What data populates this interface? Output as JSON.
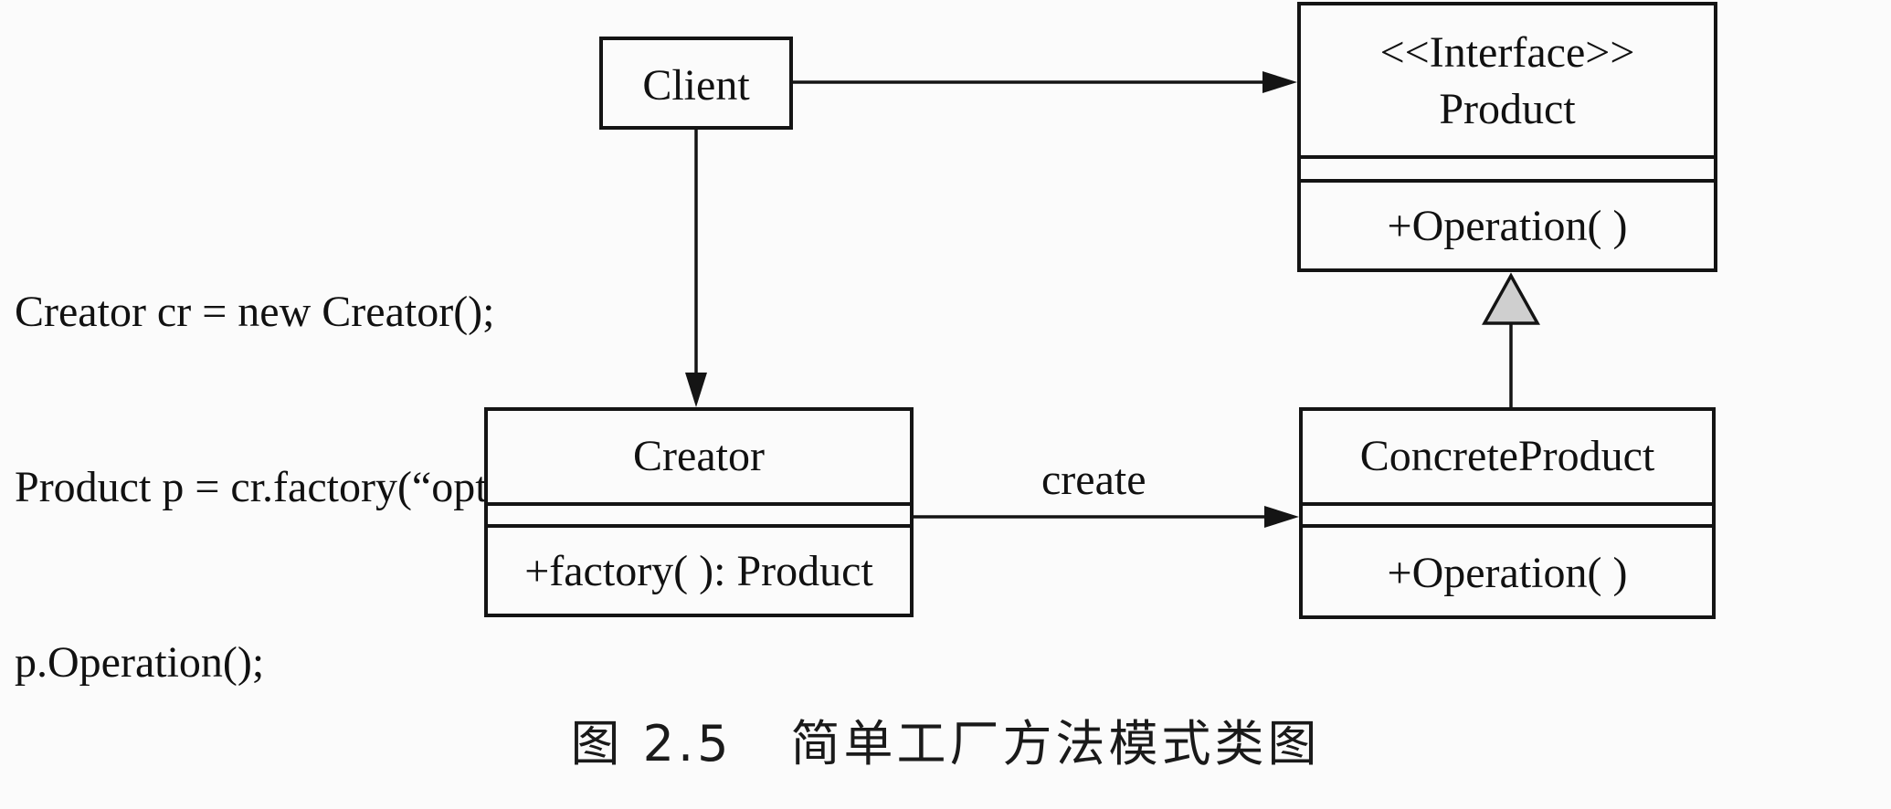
{
  "code_lines": [
    "Creator cr = new Creator();",
    "Product p = cr.factory(“option”);",
    "p.Operation();"
  ],
  "classes": {
    "client": {
      "name": "Client"
    },
    "product": {
      "stereotype": "<<Interface>>",
      "name": "Product",
      "operation": "+Operation( )"
    },
    "creator": {
      "name": "Creator",
      "operation": "+factory( ): Product"
    },
    "concrete_product": {
      "name": "ConcreteProduct",
      "operation": "+Operation( )"
    }
  },
  "edges": {
    "create_label": "create"
  },
  "caption": {
    "number": "图 2.5",
    "title": "简单工厂方法模式类图"
  }
}
